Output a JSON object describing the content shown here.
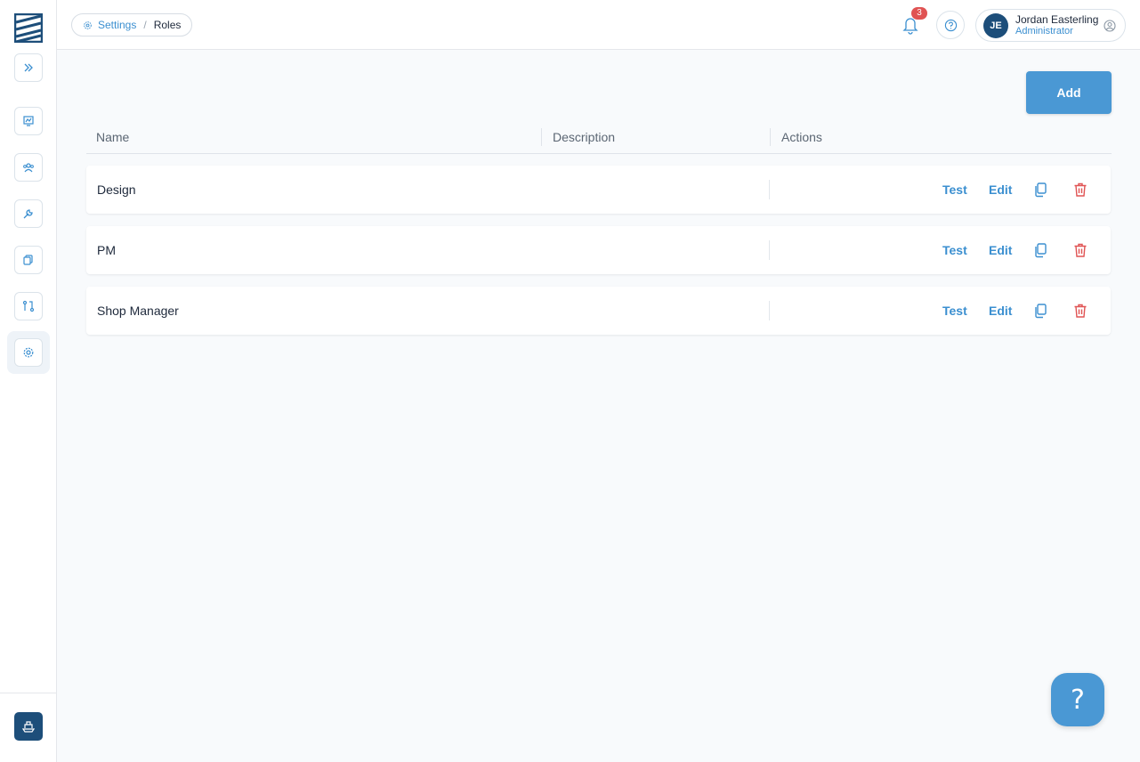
{
  "breadcrumb": {
    "parent": "Settings",
    "separator": "/",
    "current": "Roles"
  },
  "notifications": {
    "count": "3"
  },
  "user": {
    "initials": "JE",
    "name": "Jordan Easterling",
    "role": "Administrator"
  },
  "toolbar": {
    "add_label": "Add"
  },
  "table": {
    "columns": [
      "Name",
      "Description",
      "Actions"
    ],
    "rows": [
      {
        "name": "Design",
        "description": ""
      },
      {
        "name": "PM",
        "description": ""
      },
      {
        "name": "Shop Manager",
        "description": ""
      }
    ],
    "actions": {
      "test_label": "Test",
      "edit_label": "Edit"
    }
  },
  "help": {
    "label": "?"
  },
  "colors": {
    "accent": "#4a98d4",
    "link": "#3b8fd0",
    "danger": "#e05353",
    "brand": "#1d4e7a"
  },
  "icons": {
    "sidebar": [
      "logo-icon",
      "expand-icon",
      "dashboard-icon",
      "users-icon",
      "tools-icon",
      "copy-icon",
      "git-icon",
      "settings-icon"
    ],
    "bottom": "ship-icon"
  }
}
